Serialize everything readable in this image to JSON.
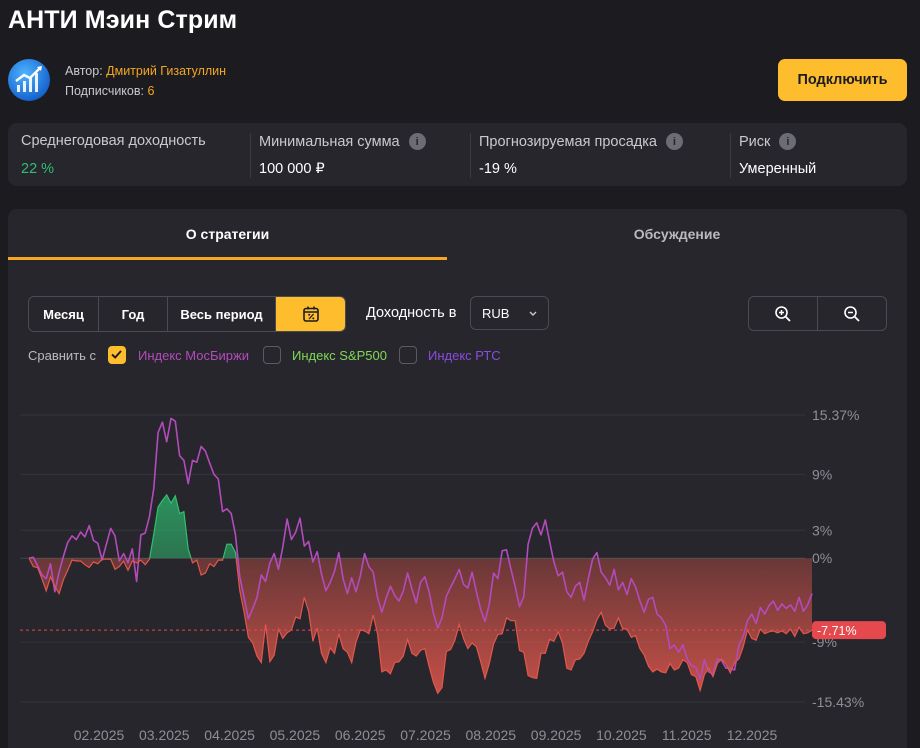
{
  "page": {
    "title": "АНТИ Мэин Стрим"
  },
  "author": {
    "label": "Автор: ",
    "name": "Дмитрий Гизатуллин",
    "subscribers_label": "Подписчиков: ",
    "subscribers_count": "6"
  },
  "actions": {
    "connect_label": "Подключить"
  },
  "stats": [
    {
      "label": "Среднегодовая доходность",
      "value": "22 %",
      "info": false,
      "accent": "#2fbf71"
    },
    {
      "label": "Минимальная сумма",
      "value": "100 000 ₽",
      "info": true
    },
    {
      "label": "Прогнозируемая просадка",
      "value": "-19 %",
      "info": true
    },
    {
      "label": "Риск",
      "value": "Умеренный",
      "info": true
    }
  ],
  "tabs": [
    {
      "label": "О стратегии",
      "active": true
    },
    {
      "label": "Обсуждение",
      "active": false
    }
  ],
  "period": {
    "buttons": [
      "Месяц",
      "Год",
      "Весь период"
    ],
    "calendar_icon": "calendar-percent-icon"
  },
  "yield": {
    "label": "Доходность в",
    "currency": "RUB"
  },
  "zoom": {
    "in_icon": "zoom-in-icon",
    "out_icon": "zoom-out-icon"
  },
  "compare": {
    "label": "Сравнить с",
    "options": [
      {
        "label": "Индекс МосБиржи",
        "checked": true,
        "color": "#b44bbd"
      },
      {
        "label": "Индекс S&P500",
        "checked": false,
        "color": "#7ed957"
      },
      {
        "label": "Индекс РТС",
        "checked": false,
        "color": "#8b4be0"
      }
    ]
  },
  "chart_data": {
    "type": "line",
    "x_labels": [
      "02.2025",
      "03.2025",
      "04.2025",
      "05.2025",
      "06.2025",
      "07.2025",
      "08.2025",
      "09.2025",
      "10.2025",
      "11.2025",
      "12.2025"
    ],
    "y_tick_labels": [
      "15.37%",
      "9%",
      "3%",
      "0%",
      "-9%",
      "-15.43%"
    ],
    "y_tick_values": [
      15.37,
      9,
      3,
      0,
      -9,
      -15.43
    ],
    "ylim": [
      -15.43,
      15.37
    ],
    "current_value_label": "-7.71%",
    "current_value": -7.71,
    "colors": {
      "strategy": "#e2574c",
      "index": "#b44bbd",
      "positive_fill": "#2fbf71",
      "badge": "#e5484d"
    },
    "series": [
      {
        "name": "Индекс МосБиржи",
        "values": [
          0.0,
          0.1,
          -0.8,
          -1.8,
          -2.2,
          -0.6,
          -3.6,
          -1.5,
          0.2,
          1.7,
          2.4,
          2.0,
          2.8,
          2.3,
          3.5,
          1.9,
          1.6,
          -0.2,
          1.5,
          3.2,
          2.4,
          -0.3,
          0.5,
          -0.5,
          1.0,
          -2.5,
          2.5,
          2.7,
          4.5,
          7.5,
          13.5,
          14.6,
          12.5,
          15.0,
          14.7,
          11.0,
          10.5,
          8.0,
          10.5,
          10.3,
          12.0,
          11.5,
          10.2,
          9.0,
          8.5,
          5.0,
          5.3,
          4.8,
          2.5,
          -2.0,
          -4.2,
          -6.5,
          -5.4,
          -4.2,
          -1.8,
          -2.5,
          -0.5,
          0.5,
          -1.2,
          1.2,
          4.2,
          2.0,
          2.8,
          4.3,
          1.3,
          1.8,
          -0.4,
          0.7,
          -1.7,
          -3.5,
          -2.6,
          -1.4,
          0.6,
          -2.2,
          -3.8,
          -2.1,
          -3.6,
          -1.9,
          0.5,
          -0.9,
          -1.5,
          -4.2,
          -5.8,
          -4.3,
          -3.0,
          -4.0,
          -4.6,
          -3.5,
          -1.6,
          -3.3,
          -4.8,
          -2.6,
          -2.0,
          -3.6,
          -5.9,
          -7.5,
          -6.4,
          -4.1,
          -3.1,
          -2.2,
          -1.2,
          -2.8,
          -3.2,
          -1.5,
          -3.6,
          -5.5,
          -6.8,
          -4.9,
          -1.6,
          -2.2,
          0.8,
          0.9,
          -1.1,
          -3.0,
          -5.2,
          -4.1,
          1.5,
          3.2,
          3.8,
          2.5,
          4.1,
          1.8,
          -0.4,
          -1.9,
          -1.5,
          -3.6,
          -4.2,
          -3.0,
          -2.6,
          -4.5,
          -2.2,
          -0.1,
          0.6,
          -1.5,
          -2.1,
          -2.9,
          -1.2,
          -3.4,
          -2.6,
          -3.9,
          -2.2,
          -3.1,
          -4.6,
          -5.8,
          -4.4,
          -4.2,
          -6.0,
          -6.4,
          -7.2,
          -9.7,
          -9.3,
          -10.1,
          -9.3,
          -10.8,
          -11.5,
          -11.7,
          -13.0,
          -10.9,
          -12.2,
          -12.4,
          -10.8,
          -11.0,
          -11.8,
          -11.8,
          -12.0,
          -9.3,
          -8.4,
          -6.7,
          -6.0,
          -7.0,
          -5.3,
          -6.0,
          -5.1,
          -4.6,
          -5.6,
          -4.9,
          -5.4,
          -5.0,
          -5.7,
          -4.2,
          -5.7,
          -5.0,
          -3.8
        ]
      },
      {
        "name": "",
        "values": [
          0.0,
          -0.9,
          -1.0,
          -2.2,
          -3.5,
          -2.0,
          -3.0,
          -3.8,
          -2.3,
          -1.3,
          -0.2,
          -0.3,
          -0.3,
          -0.7,
          -1.0,
          -0.4,
          -0.6,
          -0.1,
          -0.1,
          -0.1,
          -1.2,
          -0.9,
          -0.3,
          -1.3,
          -0.3,
          -0.5,
          -0.2,
          -0.7,
          -0.1,
          2.6,
          5.5,
          6.2,
          6.8,
          5.9,
          6.7,
          4.8,
          5.0,
          1.0,
          -0.5,
          -0.2,
          -1.8,
          -1.6,
          -0.6,
          -0.9,
          -0.2,
          -0.2,
          1.5,
          1.5,
          0.6,
          -3.5,
          -5.8,
          -8.5,
          -9.1,
          -10.5,
          -11.2,
          -7.1,
          -11.1,
          -10.4,
          -7.6,
          -8.6,
          -8.0,
          -7.7,
          -6.3,
          -6.5,
          -4.2,
          -5.7,
          -8.9,
          -7.5,
          -10.2,
          -11.2,
          -9.6,
          -10.2,
          -8.1,
          -9.7,
          -10.1,
          -11.2,
          -9.0,
          -7.7,
          -7.8,
          -8.1,
          -6.1,
          -8.1,
          -12.2,
          -12.0,
          -12.4,
          -11.2,
          -11.1,
          -10.5,
          -8.7,
          -10.2,
          -10.5,
          -9.9,
          -9.7,
          -11.6,
          -13.3,
          -14.5,
          -13.9,
          -10.0,
          -9.8,
          -8.8,
          -7.1,
          -8.6,
          -9.7,
          -9.1,
          -9.5,
          -11.1,
          -12.9,
          -11.3,
          -9.2,
          -8.2,
          -8.1,
          -6.4,
          -6.7,
          -6.7,
          -9.9,
          -10.1,
          -12.6,
          -12.8,
          -12.9,
          -10.2,
          -10.2,
          -8.7,
          -8.9,
          -7.9,
          -9.1,
          -11.8,
          -12.0,
          -10.9,
          -10.8,
          -10.2,
          -8.9,
          -7.9,
          -6.6,
          -5.8,
          -7.2,
          -7.6,
          -7.5,
          -6.4,
          -7.6,
          -7.6,
          -8.5,
          -8.3,
          -9.7,
          -10.4,
          -11.6,
          -12.2,
          -11.9,
          -12.2,
          -12.3,
          -11.3,
          -12.0,
          -11.8,
          -10.9,
          -11.2,
          -12.5,
          -12.7,
          -14.2,
          -12.5,
          -11.8,
          -12.7,
          -11.3,
          -10.8,
          -11.4,
          -12.3,
          -11.2,
          -10.8,
          -9.5,
          -7.7,
          -8.6,
          -8.8,
          -7.6,
          -8.1,
          -7.9,
          -7.8,
          -8.0,
          -7.8,
          -8.1,
          -7.6,
          -8.4,
          -7.4,
          -8.1,
          -8.0,
          -7.71
        ]
      }
    ]
  }
}
